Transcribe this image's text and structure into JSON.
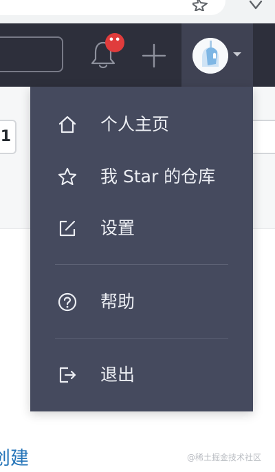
{
  "header": {
    "notification_badge": "••",
    "colors": {
      "header_bg": "#2d2f3b",
      "badge": "#e03c3c",
      "dropdown_bg": "#454a5e"
    }
  },
  "menu": {
    "items": [
      {
        "label": "个人主页",
        "icon": "home-icon"
      },
      {
        "label": "我 Star 的仓库",
        "icon": "star-icon"
      },
      {
        "label": "设置",
        "icon": "edit-icon"
      },
      {
        "label": "帮助",
        "icon": "help-icon"
      },
      {
        "label": "退出",
        "icon": "logout-icon"
      }
    ]
  },
  "page": {
    "page_number": "1",
    "create_link": "创建",
    "watermark": "@稀土掘金技术社区"
  }
}
